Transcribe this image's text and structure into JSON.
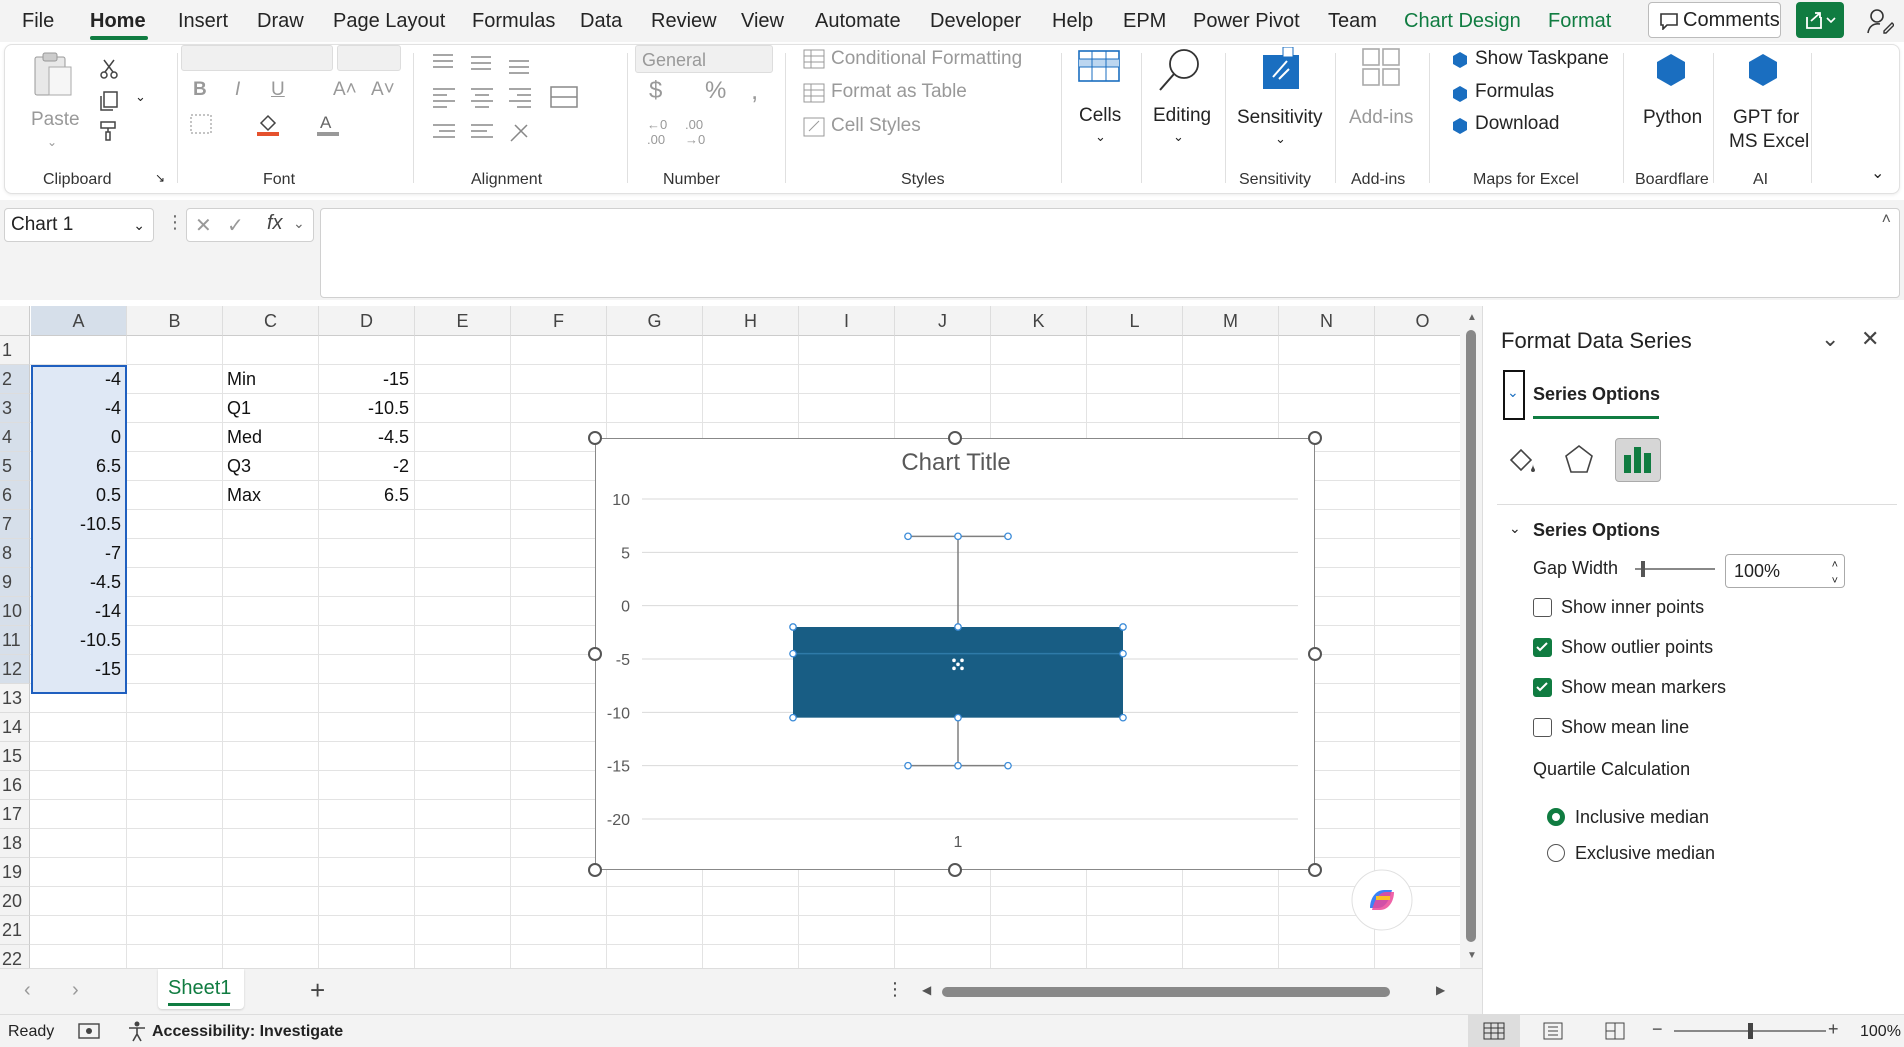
{
  "menu": {
    "items": [
      "File",
      "Home",
      "Insert",
      "Draw",
      "Page Layout",
      "Formulas",
      "Data",
      "Review",
      "View",
      "Automate",
      "Developer",
      "Help",
      "EPM",
      "Power Pivot",
      "Team",
      "Chart Design",
      "Format"
    ],
    "active": "Home",
    "comments_label": "Comments"
  },
  "ribbon": {
    "clipboard": {
      "paste": "Paste",
      "group": "Clipboard"
    },
    "font": {
      "group": "Font",
      "bold": "B",
      "italic": "I",
      "underline": "U"
    },
    "alignment": {
      "group": "Alignment"
    },
    "number": {
      "format": "General",
      "group": "Number",
      "currency": "$",
      "percent": "%",
      "comma": ","
    },
    "styles": {
      "conditional": "Conditional Formatting",
      "table": "Format as Table",
      "cell_styles": "Cell Styles",
      "group": "Styles"
    },
    "cells": {
      "label": "Cells"
    },
    "editing": {
      "label": "Editing"
    },
    "sensitivity": {
      "label": "Sensitivity",
      "group": "Sensitivity"
    },
    "addins": {
      "label": "Add-ins",
      "group": "Add-ins"
    },
    "maps": {
      "taskpane": "Show Taskpane",
      "formulas": "Formulas",
      "download": "Download",
      "group": "Maps for Excel"
    },
    "python": {
      "label": "Python",
      "group": "Boardflare"
    },
    "gpt": {
      "label1": "GPT for",
      "label2": "MS Excel",
      "group": "AI"
    }
  },
  "formula_bar": {
    "name_box": "Chart 1",
    "fx": "fx",
    "content": ""
  },
  "columns": [
    "A",
    "B",
    "C",
    "D",
    "E",
    "F",
    "G",
    "H",
    "I",
    "J",
    "K",
    "L",
    "M",
    "N",
    "O"
  ],
  "rows": [
    "1",
    "2",
    "3",
    "4",
    "5",
    "6",
    "7",
    "8",
    "9",
    "10",
    "11",
    "12",
    "13",
    "14",
    "15",
    "16",
    "17",
    "18",
    "19",
    "20",
    "21",
    "22"
  ],
  "cells": {
    "A": [
      "",
      "-4",
      "-4",
      "0",
      "6.5",
      "0.5",
      "-10.5",
      "-7",
      "-4.5",
      "-14",
      "-10.5",
      "-15"
    ],
    "C": [
      "",
      "Min",
      "Q1",
      "Med",
      "Q3",
      "Max"
    ],
    "D": [
      "",
      "-15",
      "-10.5",
      "-4.5",
      "-2",
      "6.5"
    ]
  },
  "chart_data": {
    "type": "box",
    "title": "Chart Title",
    "categories": [
      "1"
    ],
    "series": [
      {
        "min": -15,
        "q1": -10.5,
        "median": -4.5,
        "q3": -2,
        "max": 6.5
      }
    ],
    "ylim": [
      -20,
      10
    ],
    "yticks": [
      "10",
      "5",
      "0",
      "-5",
      "-10",
      "-15",
      "-20"
    ],
    "xticks": [
      "1"
    ],
    "grid": true,
    "box_color": "#185d84"
  },
  "task_pane": {
    "title": "Format Data Series",
    "tab": "Series Options",
    "section": "Series Options",
    "gap_width_label": "Gap Width",
    "gap_width_value": "100%",
    "gap_width_fraction": 0.1,
    "checkboxes": [
      {
        "label": "Show inner points",
        "checked": false
      },
      {
        "label": "Show outlier points",
        "checked": true
      },
      {
        "label": "Show mean markers",
        "checked": true
      },
      {
        "label": "Show mean line",
        "checked": false
      }
    ],
    "quartile_label": "Quartile Calculation",
    "radios": [
      {
        "label": "Inclusive median",
        "checked": true
      },
      {
        "label": "Exclusive median",
        "checked": false
      }
    ]
  },
  "sheets": {
    "tabs": [
      "Sheet1"
    ],
    "active": "Sheet1"
  },
  "status": {
    "ready": "Ready",
    "accessibility": "Accessibility: Investigate",
    "zoom": "100%",
    "zoom_fraction": 0.5
  },
  "colors": {
    "accent": "#107c41",
    "selection": "#1f5fbf",
    "box": "#185d84"
  }
}
